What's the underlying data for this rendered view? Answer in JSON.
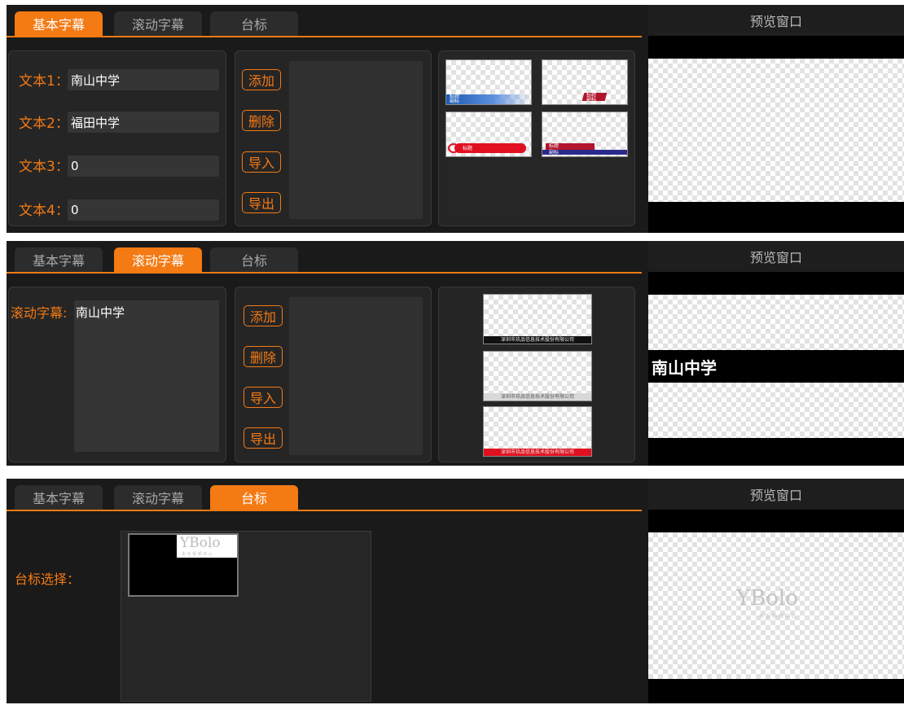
{
  "tabs": {
    "basic": "基本字幕",
    "scroll": "滚动字幕",
    "logo": "台标"
  },
  "preview": {
    "title": "预览窗口"
  },
  "basic_panel": {
    "rows": [
      {
        "label": "文本1：",
        "value": "南山中学"
      },
      {
        "label": "文本2：",
        "value": "福田中学"
      },
      {
        "label": "文本3：",
        "value": "0"
      },
      {
        "label": "文本4：",
        "value": "0"
      }
    ],
    "templates": [
      {
        "title": "标题",
        "subtitle": "副标",
        "accent": "#1f5bb5"
      },
      {
        "title": "标题",
        "subtitle": "副标",
        "accent": "#b1142c"
      },
      {
        "title": "标题",
        "accent": "#e01020"
      },
      {
        "title": "标题",
        "subtitle": "副标",
        "accent": "#2a2a8a"
      }
    ]
  },
  "actions": {
    "add": "添加",
    "delete": "删除",
    "import": "导入",
    "export": "导出"
  },
  "scroll_panel": {
    "label": "滚动字幕:",
    "value": "南山中学",
    "templates": [
      {
        "text": "深圳市玖品信息技术股份有限公司",
        "bar_color": "#111111"
      },
      {
        "text": "深圳市玖品信息技术股份有限公司",
        "bar_color": "#d8d8d8"
      },
      {
        "text": "深圳市玖品信息技术股份有限公司",
        "bar_color": "#e0101e"
      }
    ],
    "preview_text": "南山中学"
  },
  "logo_panel": {
    "label": "台标选择：",
    "logo_text": "YBolo",
    "logo_sub": "永 乐 视 频 中 心"
  },
  "colors": {
    "accent": "#f47a14",
    "bg": "#1a1a1a",
    "panel": "#252525"
  }
}
